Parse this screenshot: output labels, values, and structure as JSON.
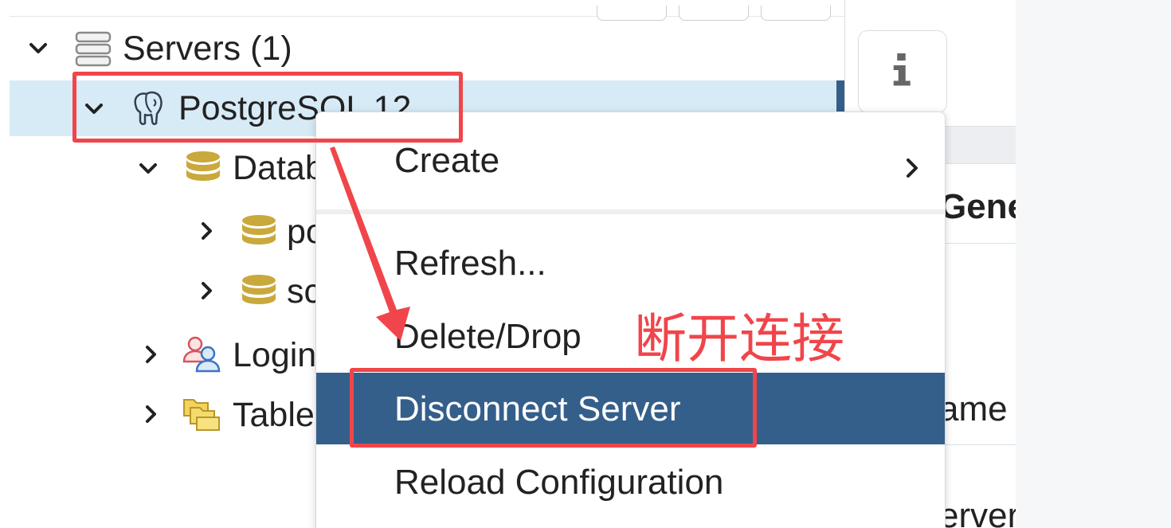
{
  "tree": {
    "servers": {
      "label": "Servers (1)",
      "icon": "server-group-icon",
      "expanded": true
    },
    "postgres_server": {
      "label": "PostgreSQL 12",
      "icon": "postgresql-elephant-icon",
      "expanded": true,
      "selected": true
    },
    "databases": {
      "label": "Datab",
      "icon": "database-stack-icon",
      "expanded": true
    },
    "db_items": [
      {
        "label": "po",
        "icon": "database-icon",
        "expanded": false
      },
      {
        "label": "sc",
        "icon": "database-icon",
        "expanded": false
      }
    ],
    "login_roles": {
      "label": "Login",
      "icon": "login-roles-icon",
      "expanded": false
    },
    "tablespaces": {
      "label": "Table",
      "icon": "tablespaces-folder-icon",
      "expanded": false
    }
  },
  "context_menu": {
    "items": [
      {
        "label": "Create",
        "has_submenu": true
      },
      {
        "label": "Refresh...",
        "has_submenu": false
      },
      {
        "label": "Delete/Drop",
        "has_submenu": false
      },
      {
        "label": "Disconnect Server",
        "has_submenu": false,
        "highlighted": true
      },
      {
        "label": "Reload Configuration",
        "has_submenu": false
      }
    ]
  },
  "right_panel": {
    "info_icon": "info-icon",
    "section_heading": "Gene",
    "field_label_1": "ame",
    "field_label_2": "erver"
  },
  "annotation": {
    "text": "断开连接",
    "color": "#f0454a"
  },
  "colors": {
    "menu_highlight": "#345f8a",
    "tree_selected_bg": "#d7ebf7",
    "annotation_red": "#f0454a"
  }
}
